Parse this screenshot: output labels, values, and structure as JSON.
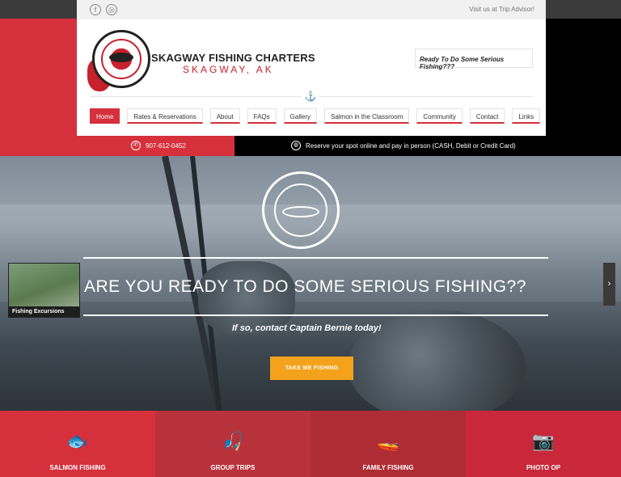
{
  "header": {
    "social": [
      "f",
      "◎"
    ],
    "trip_link": "Visit us at Trip Advisor!",
    "brand_title": "SKAGWAY FISHING CHARTERS",
    "brand_sub": "SKAGWAY, AK",
    "tagline": "Ready To Do Some Serious Fishing???"
  },
  "nav": {
    "items": [
      {
        "label": "Home"
      },
      {
        "label": "Rates & Reservations"
      },
      {
        "label": "About"
      },
      {
        "label": "FAQs"
      },
      {
        "label": "Gallery"
      },
      {
        "label": "Salmon in the Classroom"
      },
      {
        "label": "Community"
      },
      {
        "label": "Contact"
      },
      {
        "label": "Links"
      }
    ],
    "active_index": 0
  },
  "contact": {
    "phone": "907-612-0452",
    "reserve": "Reserve your spot online and pay in person (CASH, Debit or Credit Card)"
  },
  "hero": {
    "headline": "ARE YOU READY TO DO SOME SERIOUS FISHING??",
    "subline": "If so, contact Captain Bernie today!",
    "cta": "TAKE ME FISHING",
    "thumb_caption": "Fishing Excursions",
    "next_arrow": "›"
  },
  "tiles": [
    {
      "label": "SALMON FISHING",
      "icon": "fish-icon",
      "glyph": "🐟",
      "color": "#d5303c"
    },
    {
      "label": "GROUP TRIPS",
      "icon": "fisherman-icon",
      "glyph": "🎣",
      "color": "#b8323c"
    },
    {
      "label": "FAMILY FISHING",
      "icon": "boat-icon",
      "glyph": "🚤",
      "color": "#b02c34"
    },
    {
      "label": "PHOTO OP",
      "icon": "instagram-icon",
      "glyph": "📷",
      "color": "#c8283a"
    }
  ],
  "colors": {
    "accent": "#d5303c",
    "cta": "#f4a21b",
    "dark": "#000000"
  }
}
